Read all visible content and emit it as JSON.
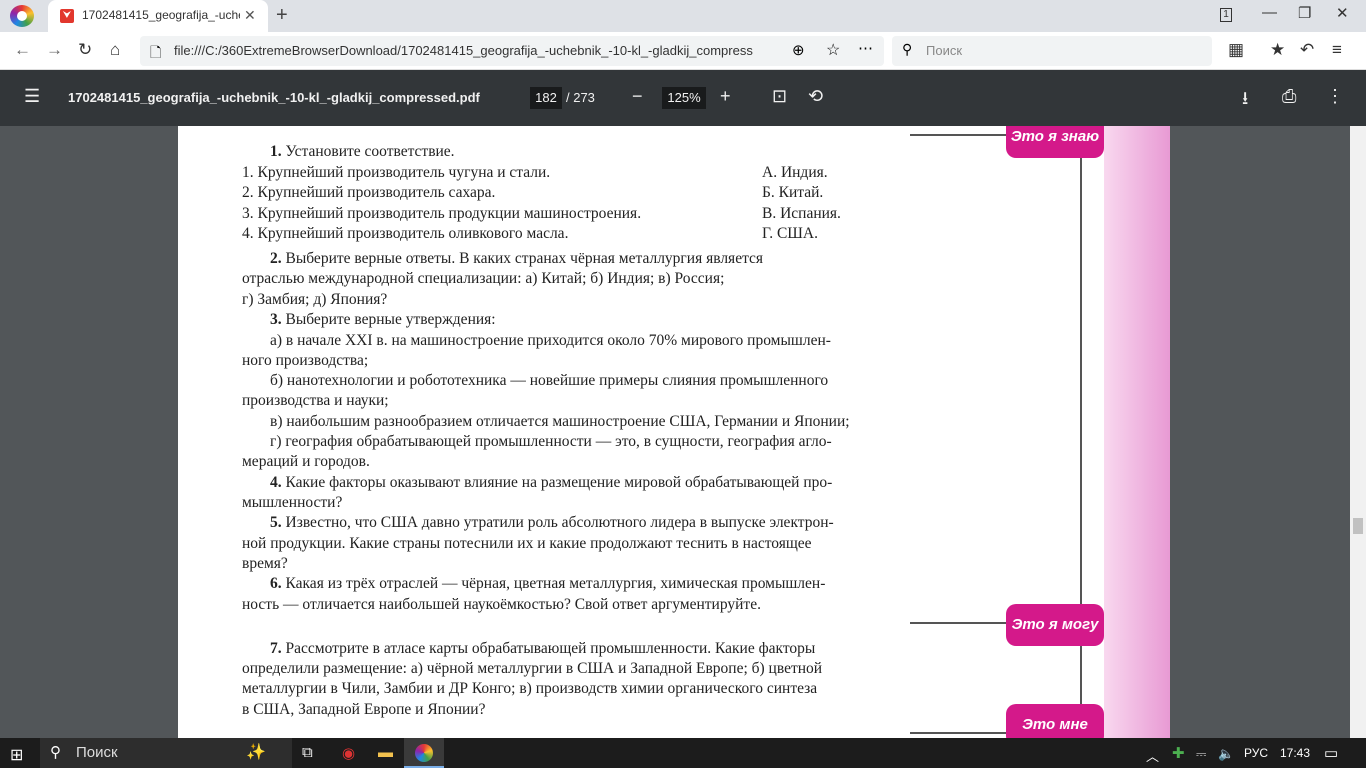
{
  "browser": {
    "tab_title": "1702481415_geografija_-uchebnik_-10-kl_-gladkij_compressed.pdf",
    "url": "file:///C:/360ExtremeBrowserDownload/1702481415_geografija_-uchebnik_-10-kl_-gladkij_compress",
    "search_placeholder": "Поиск",
    "tab_count": "1"
  },
  "pdf": {
    "title": "1702481415_geografija_-uchebnik_-10-kl_-gladkij_compressed.pdf",
    "page": "182",
    "total": "/ 273",
    "zoom": "125%"
  },
  "page": {
    "tag1": "Это я знаю",
    "tag2": "Это я могу",
    "tag3": "Это мне",
    "q1_num": "1.",
    "q1_text": "Установите соответствие.",
    "q1_items": [
      "1. Крупнейший производитель чугуна и стали.",
      "2. Крупнейший производитель сахара.",
      "3. Крупнейший производитель продукции машиностроения.",
      "4. Крупнейший производитель оливкового масла."
    ],
    "q1_answers": [
      "А. Индия.",
      "Б. Китай.",
      "В. Испания.",
      "Г. США."
    ],
    "q2_num": "2.",
    "q2_l1": "Выберите верные ответы. В каких странах чёрная металлургия является",
    "q2_l2": "отраслью международной специализации: а) Китай; б) Индия; в) Россия;",
    "q2_l3": "г) Замбия; д) Япония?",
    "q3_num": "3.",
    "q3_l1": "Выберите верные утверждения:",
    "q3_a1": "а) в начале XXI в. на машиностроение приходится около 70% мирового промышлен-",
    "q3_a2": "ного производства;",
    "q3_b1": "б) нанотехнологии и робототехника — новейшие примеры слияния промышленного",
    "q3_b2": "производства и науки;",
    "q3_c1": "в) наибольшим разнообразием отличается машиностроение США, Германии и Японии;",
    "q3_d1": "г) география обрабатывающей промышленности — это, в сущности, география агло-",
    "q3_d2": "мераций и городов.",
    "q4_num": "4.",
    "q4_l1": "Какие факторы оказывают влияние на размещение мировой обрабатывающей про-",
    "q4_l2": "мышленности?",
    "q5_num": "5.",
    "q5_l1": "Известно, что США давно утратили роль абсолютного лидера в выпуске электрон-",
    "q5_l2": "ной продукции. Какие страны потеснили их и какие продолжают теснить в настоящее",
    "q5_l3": "время?",
    "q6_num": "6.",
    "q6_l1": "Какая из трёх отраслей — чёрная, цветная металлургия, химическая промышлен-",
    "q6_l2": "ность — отличается наибольшей наукоёмкостью? Свой ответ аргументируйте.",
    "q7_num": "7.",
    "q7_l1": "Рассмотрите в атласе карты обрабатывающей промышленности. Какие факторы",
    "q7_l2": "определили размещение: а) чёрной металлургии в США и Западной Европе; б) цветной",
    "q7_l3": "металлургии в Чили, Замбии и ДР Конго; в) производств химии органического синтеза",
    "q7_l4": "в США, Западной Европе и Японии?"
  },
  "taskbar": {
    "search": "Поиск",
    "lang": "РУС",
    "time": "17:43"
  }
}
